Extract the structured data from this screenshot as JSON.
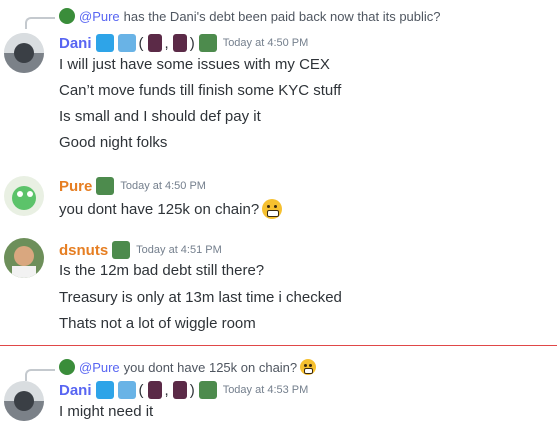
{
  "colors": {
    "dani": "#5865f2",
    "pure": "#e67e22",
    "dsnuts": "#e67e22",
    "mention": "#5865f2",
    "timestamp": "#747f8d",
    "new_divider": "#e04848"
  },
  "messages": [
    {
      "reply": {
        "mention": "@Pure",
        "text": "has the Dani's debt been paid back now that its public?"
      },
      "author": "Dani",
      "timestamp": "Today at 4:50 PM",
      "lines": [
        "I will just have some issues with my CEX",
        "Can’t move funds till finish some KYC stuff",
        "Is small and I should def pay it",
        "Good night folks"
      ]
    },
    {
      "author": "Pure",
      "timestamp": "Today at 4:50 PM",
      "lines": [
        "you dont have 125k on chain?"
      ]
    },
    {
      "author": "dsnuts",
      "timestamp": "Today at 4:51 PM",
      "lines": [
        "Is the 12m bad debt still there?",
        "Treasury is only at 13m last time i checked",
        "Thats not a lot of wiggle room"
      ]
    },
    {
      "reply": {
        "mention": "@Pure",
        "text": "you dont have 125k on chain?"
      },
      "author": "Dani",
      "timestamp": "Today at 4:53 PM",
      "lines": [
        "I might need it"
      ]
    }
  ],
  "badge_parens": {
    "open": "(",
    "comma": ",",
    "close": ")"
  }
}
